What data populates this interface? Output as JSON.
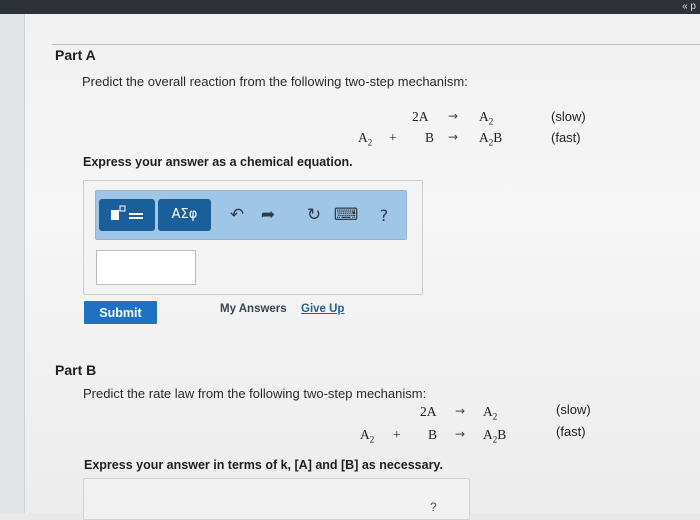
{
  "corner_text": "« p",
  "partA": {
    "title": "Part A",
    "prompt": "Predict the overall reaction from the following two-step mechanism:",
    "step1": {
      "left": "2A",
      "right_base": "A",
      "right_sub": "2",
      "note": "(slow)"
    },
    "step2": {
      "left1_base": "A",
      "left1_sub": "2",
      "plus": "+",
      "left2": "B",
      "right_base": "A",
      "right_sub": "2",
      "right_tail": "B",
      "note": "(fast)"
    },
    "instruction": "Express your answer as a chemical equation.",
    "toolbar": {
      "templates_icon": "templates-icon",
      "greek_label": "ΑΣφ",
      "undo": "↶",
      "redo": "➦",
      "reset": "↻",
      "keyboard": "⌨",
      "help": "?"
    },
    "submit_label": "Submit",
    "my_answers_label": "My Answers",
    "give_up_label": "Give Up"
  },
  "partB": {
    "title": "Part B",
    "prompt": "Predict the rate law from the following two-step mechanism:",
    "step1": {
      "left": "2A",
      "right_base": "A",
      "right_sub": "2",
      "note": "(slow)"
    },
    "step2": {
      "left1_base": "A",
      "left1_sub": "2",
      "plus": "+",
      "left2": "B",
      "right_base": "A",
      "right_sub": "2",
      "right_tail": "B",
      "note": "(fast)"
    },
    "instruction": "Express your answer in terms of k, [A] and [B] as necessary.",
    "partial_glyph": "?"
  }
}
